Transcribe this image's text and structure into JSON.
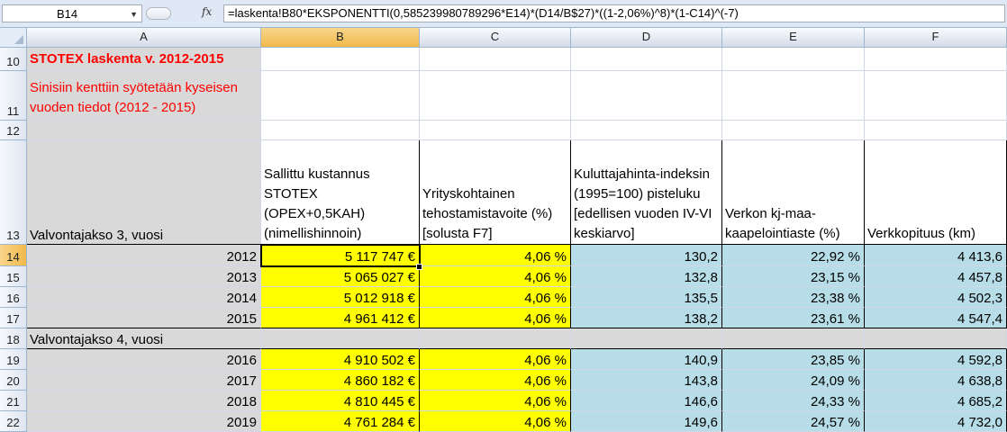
{
  "namebox": {
    "value": "B14"
  },
  "formula_bar": {
    "fx_label": "fx",
    "formula": "=laskenta!B80*EKSPONENTTI(0,585239980789296*E14)*(D14/B$27)*((1-2,06%)^8)*(1-C14)^(-7)"
  },
  "columns": [
    "A",
    "B",
    "C",
    "D",
    "E",
    "F"
  ],
  "rows": [
    "10",
    "11",
    "12",
    "13",
    "14",
    "15",
    "16",
    "17",
    "18",
    "19",
    "20",
    "21",
    "22"
  ],
  "sheet": {
    "title": "STOTEX laskenta v. 2012-2015",
    "note": "Sinisiin kenttiin syötetään kyseisen vuoden tiedot (2012 - 2015)",
    "period3_label": "Valvontajakso 3,    vuosi",
    "period4_label": "Valvontajakso 4,    vuosi",
    "headers": {
      "b": "Sallittu kustannus STOTEX (OPEX+0,5KAH) (nimellishinnoin)",
      "c": "Yrityskohtainen tehostamistavoite (%) [solusta F7]",
      "d": "Kuluttajahinta-indeksin (1995=100) pisteluku [edellisen vuoden IV-VI keskiarvo]",
      "e": "Verkon kj-maa-kaapelointiaste (%)",
      "f": "Verkkopituus (km)"
    },
    "period3_rows": [
      {
        "year": "2012",
        "stotex": "5 117 747 €",
        "target": "4,06 %",
        "index": "130,2",
        "cabling": "22,92 %",
        "length": "4 413,6"
      },
      {
        "year": "2013",
        "stotex": "5 065 027 €",
        "target": "4,06 %",
        "index": "132,8",
        "cabling": "23,15 %",
        "length": "4 457,8"
      },
      {
        "year": "2014",
        "stotex": "5 012 918 €",
        "target": "4,06 %",
        "index": "135,5",
        "cabling": "23,38 %",
        "length": "4 502,3"
      },
      {
        "year": "2015",
        "stotex": "4 961 412 €",
        "target": "4,06 %",
        "index": "138,2",
        "cabling": "23,61 %",
        "length": "4 547,4"
      }
    ],
    "period4_rows": [
      {
        "year": "2016",
        "stotex": "4 910 502 €",
        "target": "4,06 %",
        "index": "140,9",
        "cabling": "23,85 %",
        "length": "4 592,8"
      },
      {
        "year": "2017",
        "stotex": "4 860 182 €",
        "target": "4,06 %",
        "index": "143,8",
        "cabling": "24,09 %",
        "length": "4 638,8"
      },
      {
        "year": "2018",
        "stotex": "4 810 445 €",
        "target": "4,06 %",
        "index": "146,6",
        "cabling": "24,33 %",
        "length": "4 685,2"
      },
      {
        "year": "2019",
        "stotex": "4 761 284 €",
        "target": "4,06 %",
        "index": "149,6",
        "cabling": "24,57 %",
        "length": "4 732,0"
      }
    ]
  },
  "colors": {
    "yellow": "#ffff00",
    "blue": "#b7dee8",
    "gray": "#d9d9d9",
    "red": "#ff0000"
  }
}
